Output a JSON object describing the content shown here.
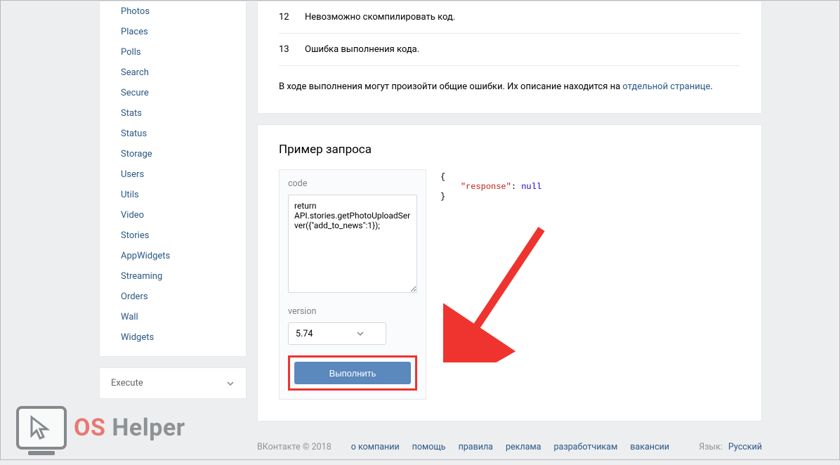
{
  "sidebar": {
    "items": [
      {
        "label": "Photos"
      },
      {
        "label": "Places"
      },
      {
        "label": "Polls"
      },
      {
        "label": "Search"
      },
      {
        "label": "Secure"
      },
      {
        "label": "Stats"
      },
      {
        "label": "Status"
      },
      {
        "label": "Storage"
      },
      {
        "label": "Users"
      },
      {
        "label": "Utils"
      },
      {
        "label": "Video"
      },
      {
        "label": "Stories"
      },
      {
        "label": "AppWidgets"
      },
      {
        "label": "Streaming"
      },
      {
        "label": "Orders"
      },
      {
        "label": "Wall"
      },
      {
        "label": "Widgets"
      }
    ],
    "execute_label": "Execute"
  },
  "errors": [
    {
      "code": "12",
      "msg": "Невозможно скомпилировать код."
    },
    {
      "code": "13",
      "msg": "Ошибка выполнения кода."
    }
  ],
  "note_text_prefix": "В ходе выполнения могут произойти общие ошибки. Их описание находится на ",
  "note_link": "отдельной странице",
  "note_text_suffix": ".",
  "example": {
    "title": "Пример запроса",
    "code_label": "code",
    "code_value": "return API.stories.getPhotoUploadServer({\"add_to_news\":1});",
    "version_label": "version",
    "version_value": "5.74",
    "button": "Выполнить",
    "response_open": "{",
    "response_key": "\"response\"",
    "response_colon": ": ",
    "response_val": "null",
    "response_close": "}"
  },
  "footer": {
    "copy": "ВКонтакте © 2018",
    "links": [
      "о компании",
      "помощь",
      "правила",
      "реклама",
      "разработчикам",
      "вакансии"
    ],
    "lang_label": "Язык:",
    "lang_value": "Русский"
  },
  "watermark": {
    "os": "OS ",
    "helper": "Helper"
  }
}
